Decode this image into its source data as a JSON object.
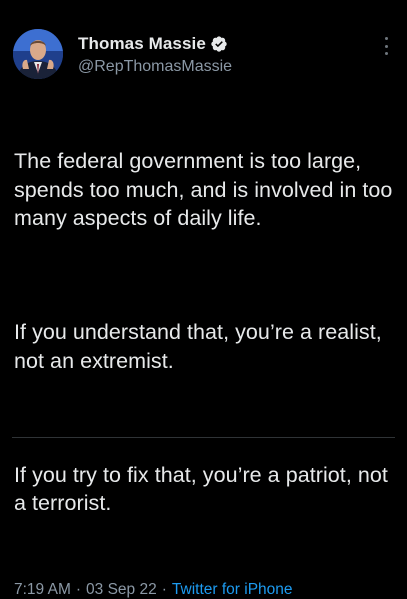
{
  "author": {
    "display_name": "Thomas Massie",
    "handle": "@RepThomasMassie",
    "verified": true,
    "avatar_icon": "user-avatar"
  },
  "tweet": {
    "paragraphs": [
      "The federal government is too large, spends too much, and is involved in too many aspects of daily life.",
      "If you understand that, you’re a realist, not an extremist.",
      "If you try to fix that, you’re a patriot, not a terrorist."
    ],
    "time": "7:19 AM",
    "date": "03 Sep 22",
    "separator": "·",
    "source": "Twitter for iPhone"
  },
  "colors": {
    "background": "#000000",
    "text": "#e7e9ea",
    "muted": "#8b98a5",
    "accent": "#1d9bf0"
  },
  "icons": {
    "verified": "verified-badge-icon",
    "more": "more-options-icon"
  }
}
